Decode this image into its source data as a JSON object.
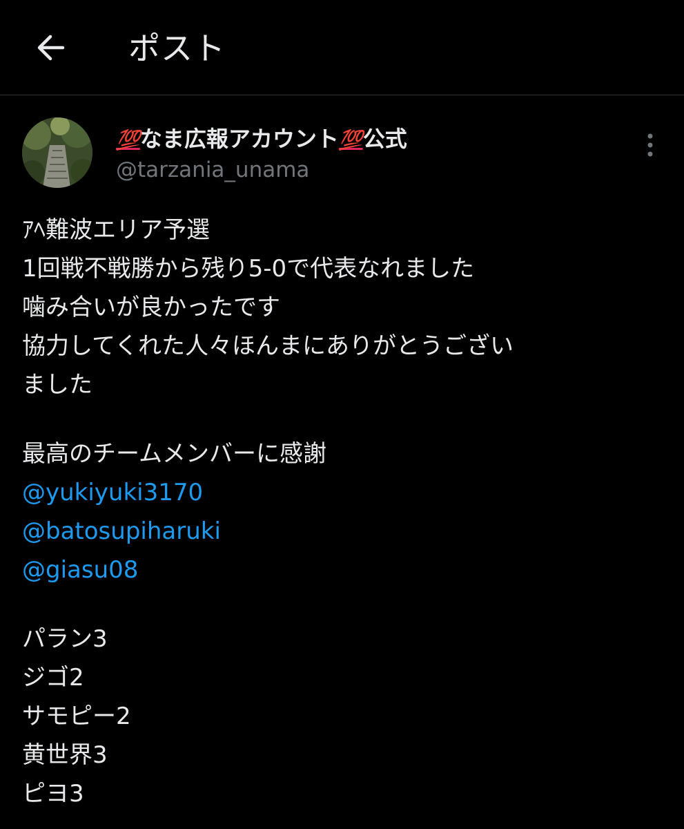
{
  "header": {
    "title": "ポスト",
    "back_icon": "arrow-left-icon"
  },
  "post": {
    "author": {
      "name_prefix_emoji": "💯",
      "name": "なま広報アカウント",
      "name_suffix_emoji": "💯",
      "name_suffix": "公式",
      "handle": "@tarzania_unama",
      "avatar_icon": "avatar-image"
    },
    "more_icon": "more-vertical-icon",
    "body_lines": [
      "ｱﾍ難波エリア予選",
      "1回戦不戦勝から残り5-0で代表なれました",
      "噛み合いが良かったです",
      "協力してくれた人々ほんまにありがとうござい",
      "ました"
    ],
    "thanks_line": "最高のチームメンバーに感謝",
    "mentions": [
      "@yukiyuki3170",
      "@batosupiharuki",
      "@giasu08"
    ],
    "picks": [
      "パラン3",
      "ジゴ2",
      "サモピー2",
      "黄世界3",
      "ピヨ3"
    ]
  },
  "colors": {
    "background": "#000000",
    "text": "#e7e9ea",
    "secondary": "#71767b",
    "link": "#1d9bf0",
    "divider": "#2f3336"
  }
}
